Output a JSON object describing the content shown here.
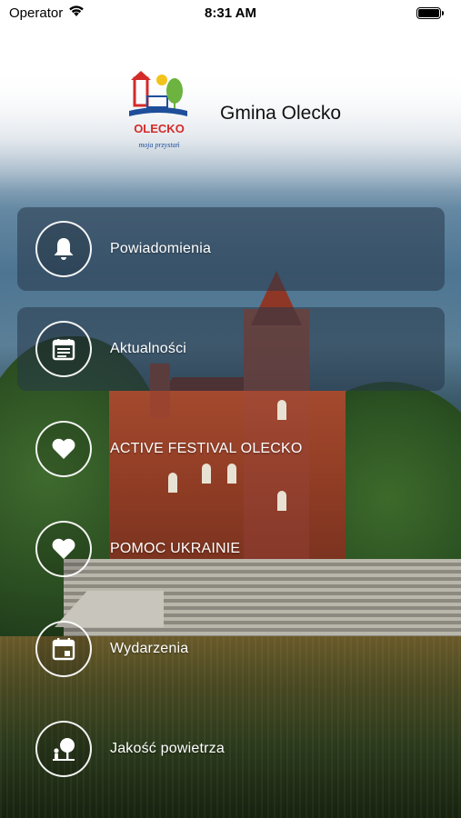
{
  "status_bar": {
    "carrier": "Operator",
    "time": "8:31 AM"
  },
  "header": {
    "title": "Gmina Olecko",
    "logo_text": "OLECKO",
    "logo_tagline": "moja przystań"
  },
  "menu": {
    "items": [
      {
        "label": "Powiadomienia",
        "icon": "bell-icon"
      },
      {
        "label": "Aktualności",
        "icon": "news-icon"
      },
      {
        "label": "ACTIVE FESTIVAL OLECKO",
        "icon": "heart-icon"
      },
      {
        "label": "POMOC UKRAINIE",
        "icon": "heart-icon"
      },
      {
        "label": "Wydarzenia",
        "icon": "calendar-icon"
      },
      {
        "label": "Jakość powietrza",
        "icon": "tree-person-icon"
      }
    ]
  },
  "colors": {
    "panel": "#263748",
    "icon_stroke": "#ffffff",
    "logo_blue": "#1e4e9a",
    "logo_red": "#d42a2a",
    "logo_green": "#6cb33f",
    "logo_yellow": "#f3c31b"
  }
}
